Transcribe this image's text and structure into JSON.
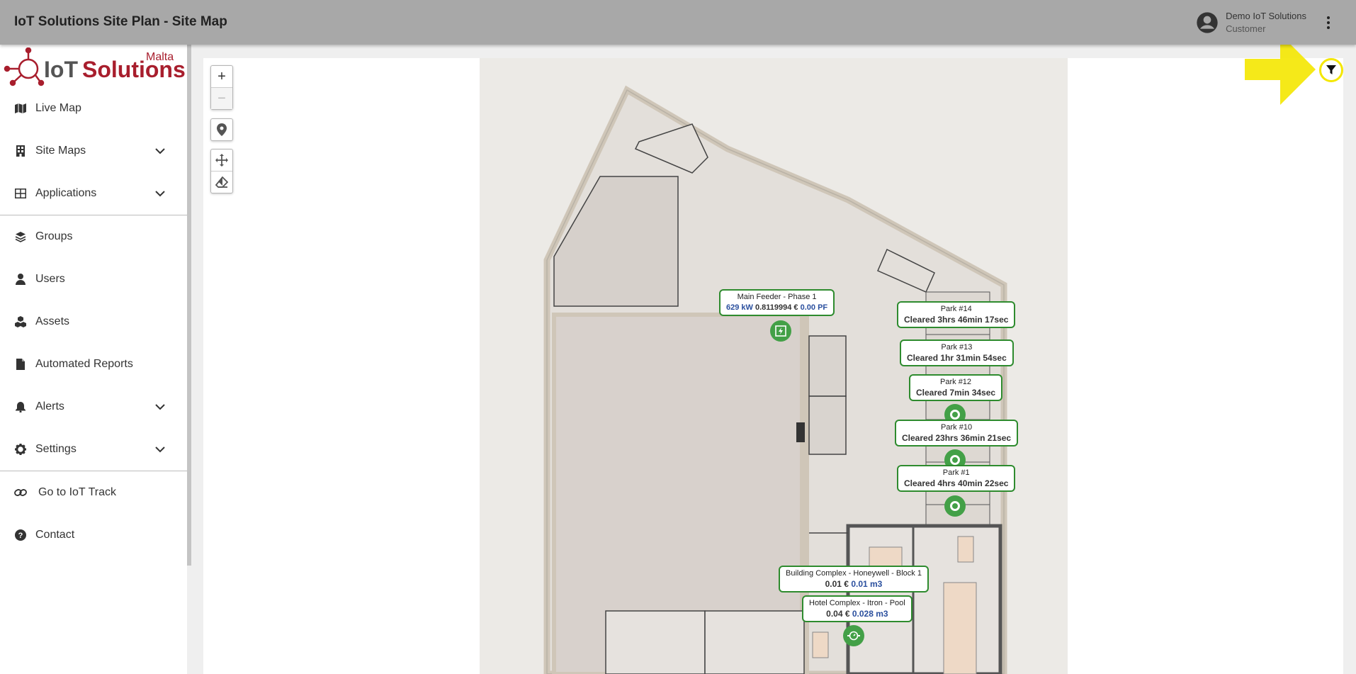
{
  "app": {
    "title": "IoT Solutions Site Plan - Site Map"
  },
  "user": {
    "name": "Demo IoT Solutions",
    "role": "Customer"
  },
  "brand": {
    "logo_text": "IoT Solutions",
    "logo_sub": "Malta",
    "accent": "#a81e2d"
  },
  "sidebar": {
    "items": [
      {
        "label": "Live Map",
        "icon": "map-icon"
      },
      {
        "label": "Site Maps",
        "icon": "building-icon"
      },
      {
        "label": "Applications",
        "icon": "grid-icon"
      },
      {
        "label": "Groups",
        "icon": "layers-icon"
      },
      {
        "label": "Users",
        "icon": "user-icon"
      },
      {
        "label": "Assets",
        "icon": "cubes-icon"
      },
      {
        "label": "Automated Reports",
        "icon": "file-icon"
      },
      {
        "label": "Alerts",
        "icon": "bell-icon"
      },
      {
        "label": "Settings",
        "icon": "gear-icon"
      },
      {
        "label": "Go to IoT Track",
        "icon": "link-icon"
      },
      {
        "label": "Contact",
        "icon": "question-icon"
      }
    ]
  },
  "map": {
    "zoom_in": "+",
    "zoom_out": "−",
    "labels": {
      "feeder": {
        "title": "Main Feeder - Phase 1",
        "v1": "629 kW",
        "v2": " 0.8119994 € ",
        "v3": "0.00 PF"
      },
      "park14": {
        "title": "Park #14",
        "status": "Cleared 3hrs 46min 17sec"
      },
      "park13": {
        "title": "Park #13",
        "status": "Cleared 1hr 31min 54sec"
      },
      "park12": {
        "title": "Park #12",
        "status": "Cleared 7min 34sec"
      },
      "park10": {
        "title": "Park #10",
        "status": "Cleared 23hrs 36min 21sec"
      },
      "park1": {
        "title": "Park #1",
        "status": "Cleared 4hrs 40min 22sec"
      },
      "building": {
        "title": "Building Complex - Honeywell - Block 1",
        "v1": "0.01 €",
        "v2": "0.01 m3"
      },
      "hotel": {
        "title": "Hotel Complex - Itron - Pool",
        "v1": "0.04 €",
        "v2": "0.028 m3"
      }
    }
  },
  "colors": {
    "marker": "#43a047",
    "tag_border": "#2e8b2e",
    "highlight": "#f4e700"
  }
}
